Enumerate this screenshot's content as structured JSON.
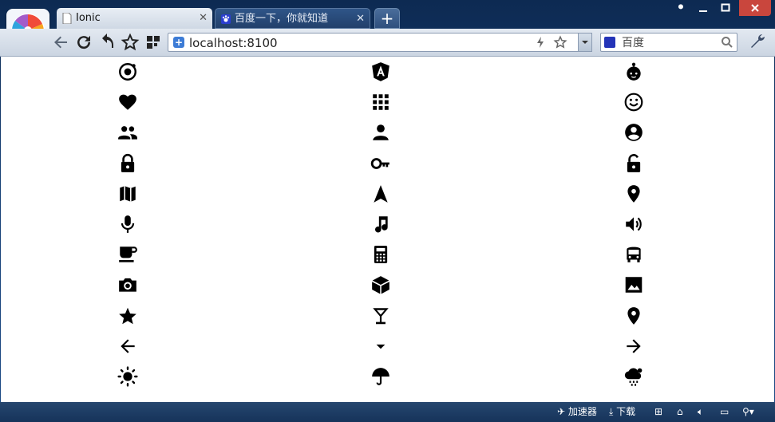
{
  "browser": {
    "tabs": [
      {
        "title": "Ionic",
        "active": true
      },
      {
        "title": "百度一下，你就知道",
        "active": false
      }
    ],
    "new_tab_label": "+",
    "address": "localhost:8100",
    "search_placeholder": "百度"
  },
  "window_controls": [
    "skin",
    "minimize",
    "maximize",
    "close"
  ],
  "icon_grid": {
    "rows": [
      [
        "ionic-icon",
        "angular-icon",
        "baby-icon"
      ],
      [
        "heart-icon",
        "apps-grid-icon",
        "happy-face-icon"
      ],
      [
        "people-icon",
        "person-icon",
        "contact-icon"
      ],
      [
        "lock-icon",
        "key-icon",
        "unlock-icon"
      ],
      [
        "map-icon",
        "navigate-icon",
        "location-pin-icon"
      ],
      [
        "microphone-icon",
        "music-note-icon",
        "volume-icon"
      ],
      [
        "cafe-cup-icon",
        "calculator-icon",
        "bus-icon"
      ],
      [
        "camera-icon",
        "cube-icon",
        "image-icon"
      ],
      [
        "star-icon",
        "wine-glass-icon",
        "pin-icon"
      ],
      [
        "arrow-back-icon",
        "arrow-down-icon",
        "arrow-forward-icon"
      ],
      [
        "sunny-icon",
        "umbrella-icon",
        "rainy-cloud-icon"
      ]
    ]
  },
  "status_bar": {
    "accelerator": "加速器",
    "download": "下载"
  }
}
